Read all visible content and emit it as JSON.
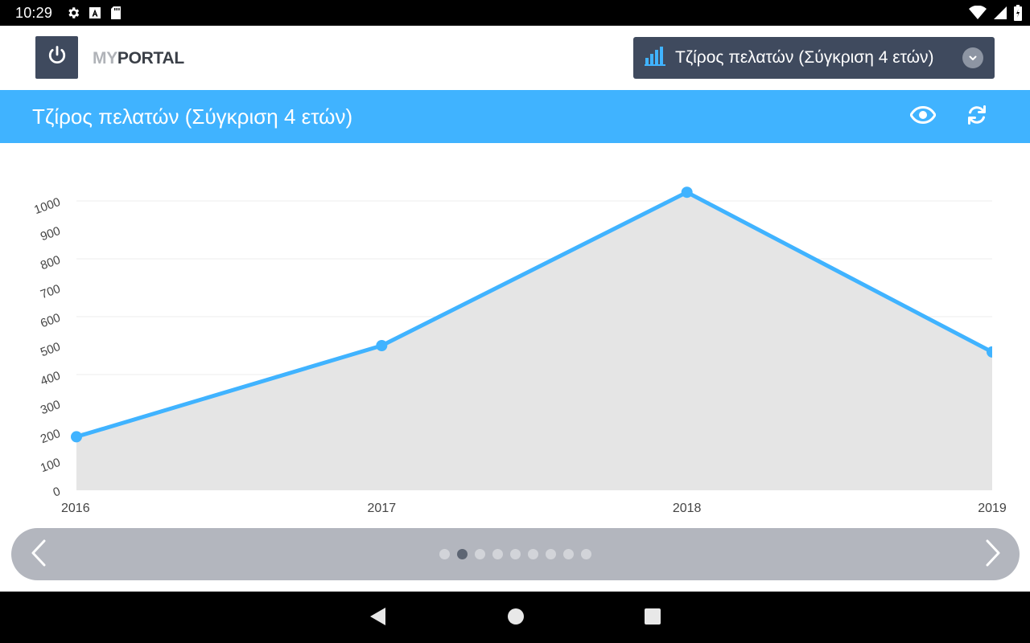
{
  "status_bar": {
    "time": "10:29",
    "left_icons": [
      "gear-icon",
      "font-a-icon",
      "sd-card-icon"
    ],
    "right_icons": [
      "wifi-icon",
      "signal-icon",
      "battery-icon"
    ]
  },
  "header": {
    "logo_my": "MY",
    "logo_portal": "PORTAL",
    "power_icon": "power-icon",
    "report_selector": {
      "icon": "bar-chart-icon",
      "selected": "Τζίρος πελατών (Σύγκριση 4 ετών)",
      "chevron": "chevron-down-icon"
    }
  },
  "title_bar": {
    "title": "Τζίρος πελατών (Σύγκριση 4 ετών)",
    "view_icon": "eye-icon",
    "refresh_icon": "refresh-icon"
  },
  "colors": {
    "accent": "#40b3ff",
    "dark": "#3f4a5e",
    "line": "#40b3ff",
    "area": "#e5e5e5"
  },
  "chart_data": {
    "type": "area",
    "categories": [
      "2016",
      "2017",
      "2018",
      "2019"
    ],
    "series": [
      {
        "values": [
          185,
          500,
          1030,
          478
        ]
      }
    ],
    "yticks": [
      "0",
      "100",
      "200",
      "300",
      "400",
      "500",
      "600",
      "700",
      "800",
      "900",
      "1000"
    ],
    "ylim": [
      0,
      1000
    ],
    "grid": true
  },
  "pager": {
    "prev_icon": "chevron-left-icon",
    "next_icon": "chevron-right-icon",
    "page_count": 9,
    "active_index": 1
  },
  "nav_bar": {
    "back_icon": "back-triangle-icon",
    "home_icon": "home-circle-icon",
    "recents_icon": "recents-square-icon"
  }
}
